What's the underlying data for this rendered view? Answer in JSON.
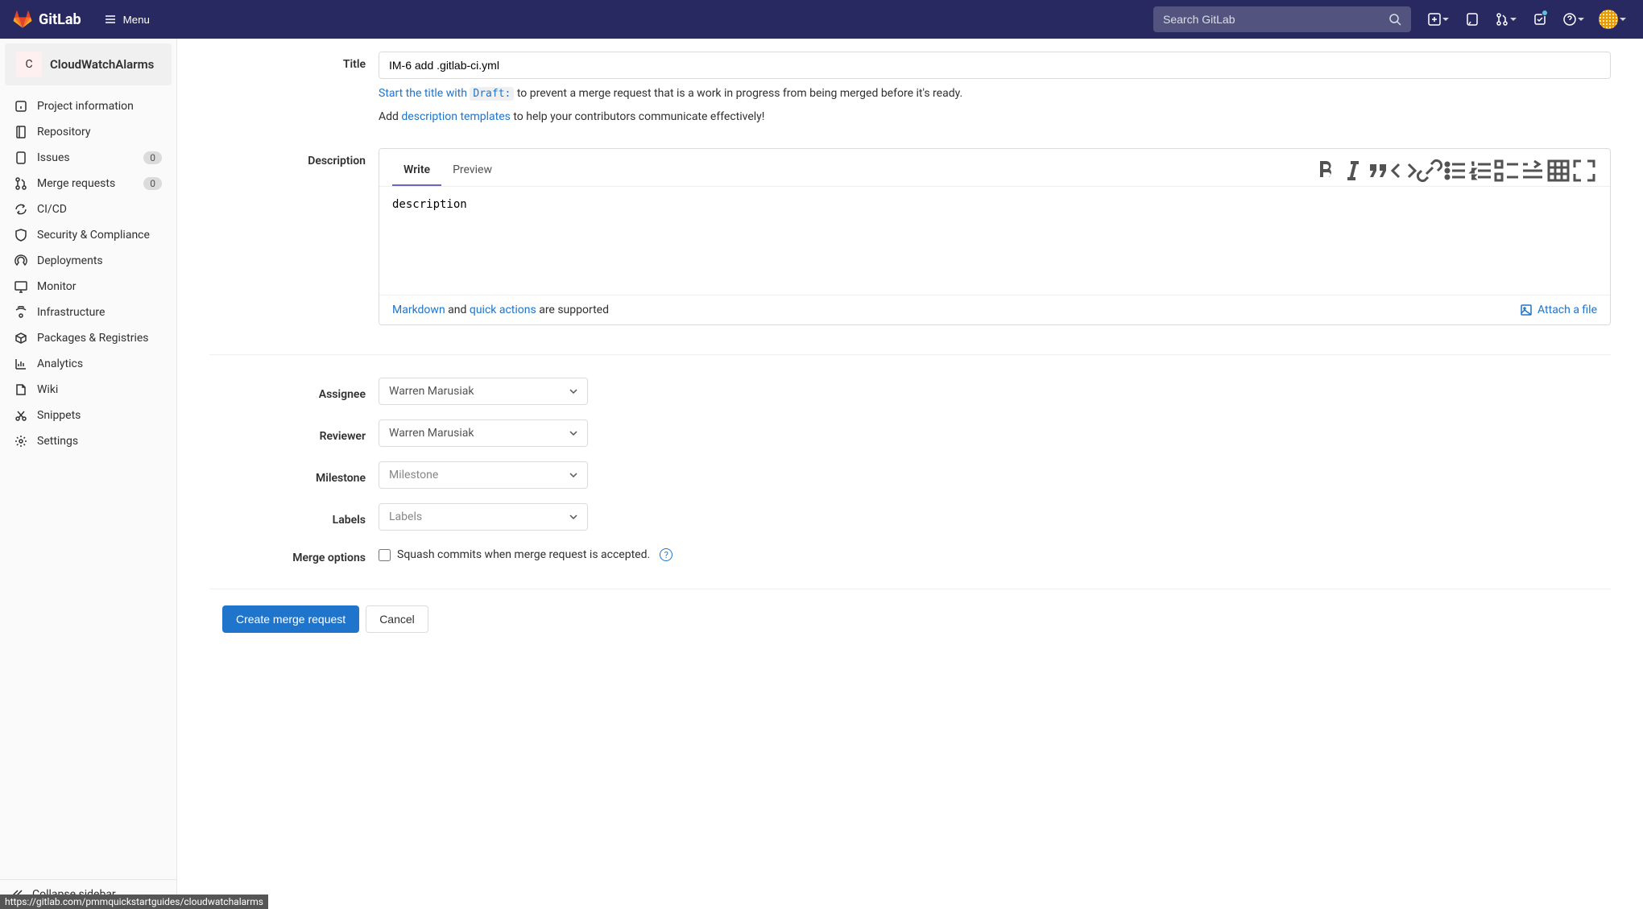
{
  "header": {
    "brand": "GitLab",
    "menu": "Menu",
    "search_placeholder": "Search GitLab"
  },
  "project": {
    "initial": "C",
    "name": "CloudWatchAlarms"
  },
  "sidebar": {
    "items": [
      {
        "label": "Project information"
      },
      {
        "label": "Repository"
      },
      {
        "label": "Issues",
        "badge": "0"
      },
      {
        "label": "Merge requests",
        "badge": "0"
      },
      {
        "label": "CI/CD"
      },
      {
        "label": "Security & Compliance"
      },
      {
        "label": "Deployments"
      },
      {
        "label": "Monitor"
      },
      {
        "label": "Infrastructure"
      },
      {
        "label": "Packages & Registries"
      },
      {
        "label": "Analytics"
      },
      {
        "label": "Wiki"
      },
      {
        "label": "Snippets"
      },
      {
        "label": "Settings"
      }
    ],
    "collapse": "Collapse sidebar"
  },
  "form": {
    "title_label": "Title",
    "title_value": "IM-6 add .gitlab-ci.yml",
    "hint1_link": "Start the title with",
    "hint1_code": "Draft:",
    "hint1_rest": " to prevent a merge request that is a work in progress from being merged before it's ready.",
    "hint2_prefix": "Add ",
    "hint2_link": "description templates",
    "hint2_rest": " to help your contributors communicate effectively!",
    "description_label": "Description",
    "tabs": {
      "write": "Write",
      "preview": "Preview"
    },
    "description_value": "description",
    "md_link": "Markdown",
    "md_and": " and ",
    "qa_link": "quick actions",
    "md_rest": " are supported",
    "attach": "Attach a file",
    "assignee_label": "Assignee",
    "assignee_value": "Warren Marusiak",
    "reviewer_label": "Reviewer",
    "reviewer_value": "Warren Marusiak",
    "milestone_label": "Milestone",
    "milestone_placeholder": "Milestone",
    "labels_label": "Labels",
    "labels_placeholder": "Labels",
    "merge_options_label": "Merge options",
    "squash_label": "Squash commits when merge request is accepted.",
    "create_btn": "Create merge request",
    "cancel_btn": "Cancel"
  },
  "status_url": "https://gitlab.com/pmmquickstartguides/cloudwatchalarms"
}
